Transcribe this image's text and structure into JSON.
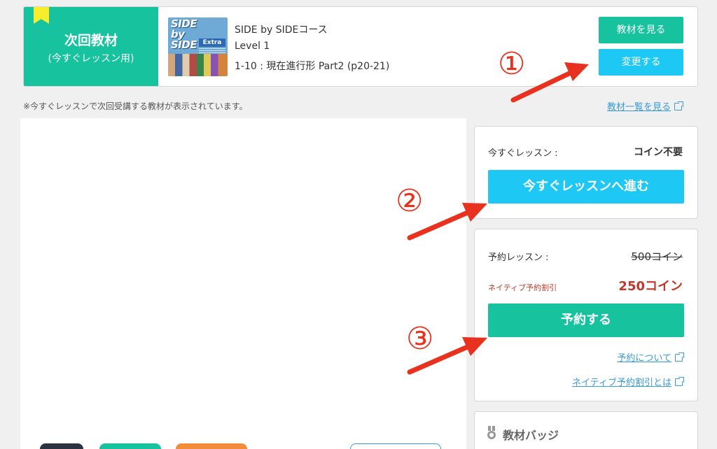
{
  "next_material": {
    "title": "次回教材",
    "subtitle": "(今すぐレッスン用)",
    "course_name": "SIDE by SIDEコース",
    "level": "Level 1",
    "lesson": "1-10 : 現在進行形 Part2 (p20-21)",
    "thumbnail_text": "SIDE by SIDE",
    "thumbnail_badge": "Extra",
    "view_button": "教材を見る",
    "change_button": "変更する"
  },
  "note": "※今すぐレッスンで次回受講する教材が表示されています。",
  "material_list_link": "教材一覧を見る",
  "lesson_now": {
    "label": "今すぐレッスン :",
    "value": "コイン不要",
    "button": "今すぐレッスンへ進む"
  },
  "reservation": {
    "label": "予約レッスン :",
    "original_price": "500コイン",
    "discount_label": "ネイティブ予約割引",
    "discount_price": "250コイン",
    "button": "予約する",
    "about_link": "予約について",
    "discount_link": "ネイティブ予約割引とは"
  },
  "badge_section": {
    "title": "教材バッジ"
  },
  "annotations": [
    "①",
    "②",
    "③"
  ],
  "colors": {
    "green": "#17c39e",
    "cyan": "#1ec8f5",
    "red": "#c0392b",
    "link": "#3b9ad9",
    "arrow": "#e8321f"
  }
}
